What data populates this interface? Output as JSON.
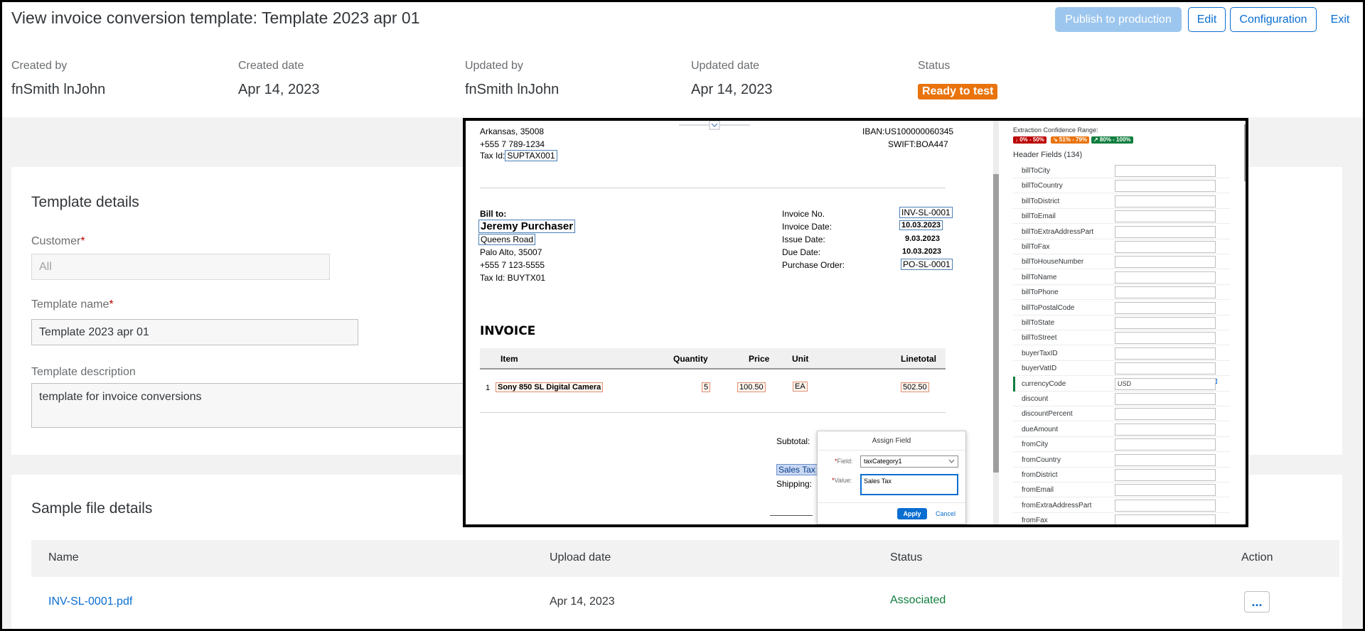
{
  "header": {
    "title": "View invoice conversion template: Template 2023 apr 01",
    "publish_label": "Publish to production",
    "edit_label": "Edit",
    "config_label": "Configuration",
    "exit_label": "Exit",
    "created_by_label": "Created by",
    "created_by": "fnSmith lnJohn",
    "created_date_label": "Created date",
    "created_date": "Apr 14, 2023",
    "updated_by_label": "Updated by",
    "updated_by": "fnSmith lnJohn",
    "updated_date_label": "Updated date",
    "updated_date": "Apr 14, 2023",
    "status_label": "Status",
    "status": "Ready to test"
  },
  "template_details": {
    "title": "Template details",
    "customer_label": "Customer",
    "customer_value": "All",
    "name_label": "Template name",
    "name_value": "Template 2023 apr 01",
    "desc_label": "Template description",
    "desc_value": "template for invoice conversions"
  },
  "sample_files": {
    "title": "Sample file details",
    "columns": [
      "Name",
      "Upload date",
      "Status",
      "Action"
    ],
    "rows": [
      {
        "name": "INV-SL-0001.pdf",
        "upload_date": "Apr 14, 2023",
        "status": "Associated",
        "action": "..."
      }
    ]
  },
  "invoice": {
    "addr_line1": "Arkansas, 35008",
    "phone1": "+555 7 789-1234",
    "tax_id_label": "Tax Id:",
    "tax_id": "SUPTAX001",
    "iban": "IBAN:US100000060345",
    "swift": "SWIFT:BOA447",
    "bill_to": "Bill to:",
    "buyer_name": "Jeremy Purchaser",
    "buyer_street": "Queens Road",
    "buyer_city": "Palo Alto, 35007",
    "buyer_phone": "+555 7 123-5555",
    "buyer_tax": "Tax Id: BUYTX01",
    "inv_no_label": "Invoice No.",
    "inv_no": "INV-SL-0001",
    "inv_date_label": "Invoice Date:",
    "inv_date": "10.03.2023",
    "issue_date_label": "Issue Date:",
    "issue_date": "9.03.2023",
    "due_date_label": "Due Date:",
    "due_date": "10.03.2023",
    "po_label": "Purchase Order:",
    "po": "PO-SL-0001",
    "heading": "INVOICE",
    "col_item": "Item",
    "col_qty": "Quantity",
    "col_price": "Price",
    "col_unit": "Unit",
    "col_total": "Linetotal",
    "line_no": "1",
    "line_item": "Sony 850 SL Digital Camera",
    "line_qty": "5",
    "line_price": "100.50",
    "line_unit": "EA",
    "line_total": "502.50",
    "subtotal_label": "Subtotal:",
    "sales_tax_label": "Sales Tax",
    "shipping_label": "Shipping:"
  },
  "extraction_panel": {
    "conf_title": "Extraction Confidence Range:",
    "conf_low": "↓ 0% - 50%",
    "conf_mid": "↘ 51% - 79%",
    "conf_high": "↗ 80% - 100%",
    "colors": {
      "low": "#bb0000",
      "mid": "#e9730c",
      "high": "#107e3e"
    },
    "header_fields_title": "Header Fields (134)",
    "fields": [
      {
        "name": "billToCity",
        "value": ""
      },
      {
        "name": "billToCountry",
        "value": ""
      },
      {
        "name": "billToDistrict",
        "value": ""
      },
      {
        "name": "billToEmail",
        "value": ""
      },
      {
        "name": "billToExtraAddressPart",
        "value": ""
      },
      {
        "name": "billToFax",
        "value": ""
      },
      {
        "name": "billToHouseNumber",
        "value": ""
      },
      {
        "name": "billToName",
        "value": ""
      },
      {
        "name": "billToPhone",
        "value": ""
      },
      {
        "name": "billToPostalCode",
        "value": ""
      },
      {
        "name": "billToState",
        "value": ""
      },
      {
        "name": "billToStreet",
        "value": ""
      },
      {
        "name": "buyerTaxID",
        "value": ""
      },
      {
        "name": "buyerVatID",
        "value": ""
      },
      {
        "name": "currencyCode",
        "value": "USD"
      },
      {
        "name": "discount",
        "value": ""
      },
      {
        "name": "discountPercent",
        "value": ""
      },
      {
        "name": "dueAmount",
        "value": ""
      },
      {
        "name": "fromCity",
        "value": ""
      },
      {
        "name": "fromCountry",
        "value": ""
      },
      {
        "name": "fromDistrict",
        "value": ""
      },
      {
        "name": "fromEmail",
        "value": ""
      },
      {
        "name": "fromExtraAddressPart",
        "value": ""
      },
      {
        "name": "fromFax",
        "value": ""
      }
    ]
  },
  "assign_popup": {
    "title": "Assign Field",
    "field_label": "Field:",
    "field_value": "taxCategory1",
    "value_label": "Value:",
    "value_text": "Sales Tax",
    "apply_label": "Apply",
    "cancel_label": "Cancel"
  }
}
